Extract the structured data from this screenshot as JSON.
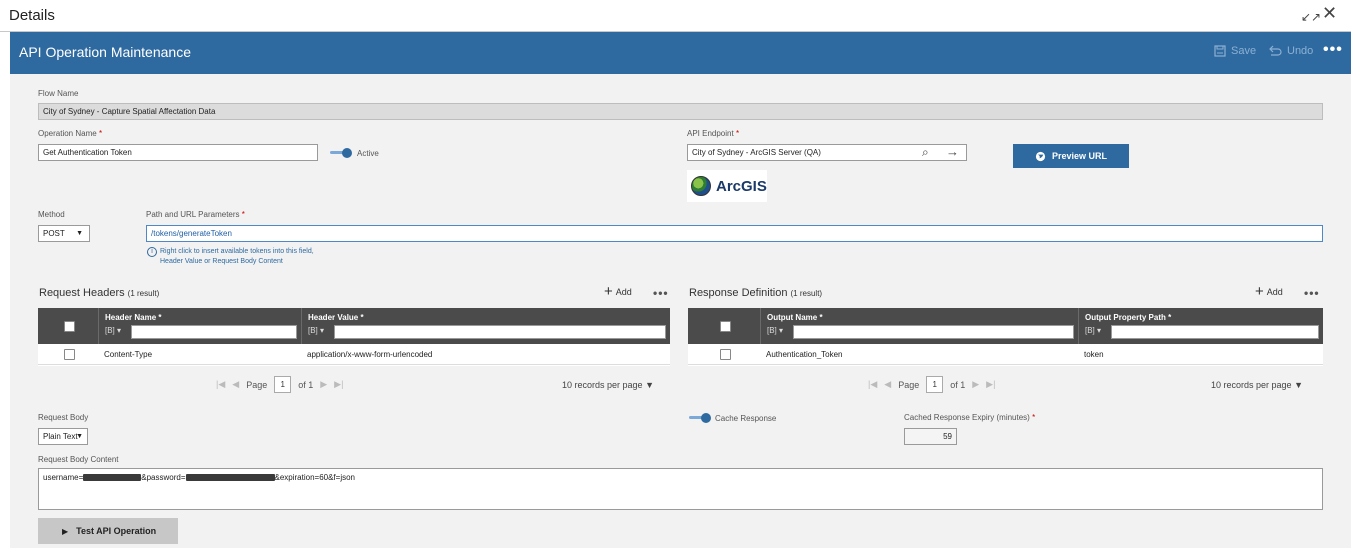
{
  "window": {
    "title": "Details",
    "icons": [
      "collapse-icon",
      "close-icon"
    ]
  },
  "header": {
    "title": "API Operation Maintenance",
    "save_label": "Save",
    "undo_label": "Undo",
    "brand_color": "#2e6aa0"
  },
  "form": {
    "flow_name": {
      "label": "Flow Name",
      "value": "City of Sydney - Capture Spatial Affectation Data"
    },
    "operation_name": {
      "label": "Operation Name",
      "required": "*",
      "value": "Get Authentication Token"
    },
    "active": {
      "label": "Active",
      "state": "on"
    },
    "api_endpoint": {
      "label": "API Endpoint",
      "required": "*",
      "value": "City of Sydney - ArcGIS Server (QA)"
    },
    "preview_url_label": "Preview URL",
    "endpoint_logo_text": "ArcGIS",
    "method": {
      "label": "Method",
      "value": "POST"
    },
    "path": {
      "label": "Path and URL Parameters",
      "required": "*",
      "value": "/tokens/generateToken"
    },
    "hint_line1": "Right click to insert available tokens into this field,",
    "hint_line2": "Header Value or Request Body Content",
    "request_body": {
      "label": "Request Body",
      "value": "Plain Text"
    },
    "cache_response": {
      "label": "Cache Response",
      "state": "on"
    },
    "cache_expiry": {
      "label": "Cached Response Expiry (minutes)",
      "required": "*",
      "value": "59"
    },
    "request_body_content": {
      "label": "Request Body Content",
      "part1": "username=",
      "part2": "&password=",
      "part3": "&expiration=60&f=json"
    },
    "test_button_label": "Test API Operation"
  },
  "request_headers": {
    "title": "Request Headers",
    "count": "(1 result)",
    "add_label": "Add",
    "columns": [
      "Header Name *",
      "Header Value *"
    ],
    "filter_label": "[B] ▾",
    "rows": [
      {
        "name": "Content-Type",
        "value": "application/x-www-form-urlencoded"
      }
    ],
    "pager": {
      "page_label": "Page",
      "page": "1",
      "of": "of 1",
      "per_page": "10 records per page"
    }
  },
  "response_definition": {
    "title": "Response Definition",
    "count": "(1 result)",
    "add_label": "Add",
    "columns": [
      "Output Name *",
      "Output Property Path *"
    ],
    "filter_label": "[B] ▾",
    "rows": [
      {
        "name": "Authentication_Token",
        "path": "token"
      }
    ],
    "pager": {
      "page_label": "Page",
      "page": "1",
      "of": "of 1",
      "per_page": "10 records per page"
    }
  }
}
